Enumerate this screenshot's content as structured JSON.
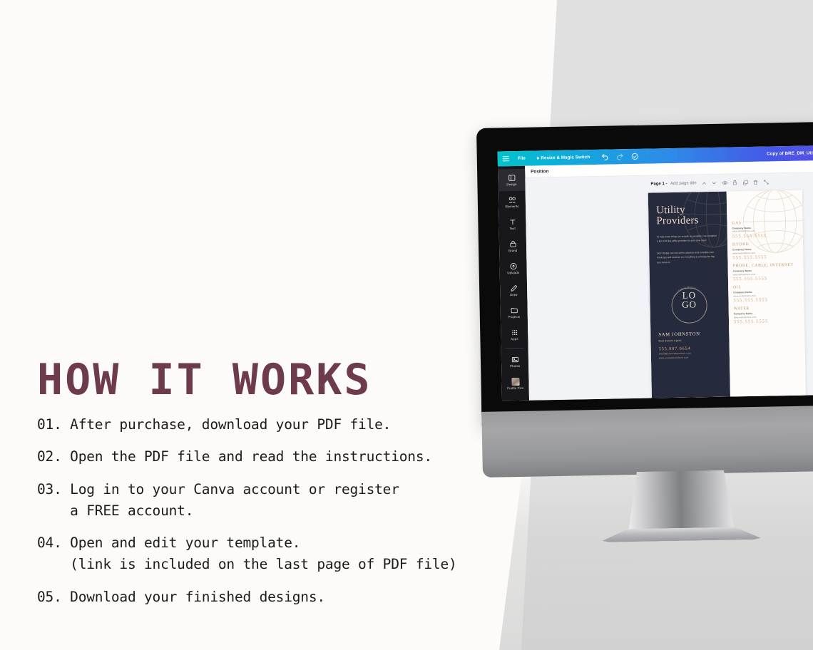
{
  "background": {
    "left_color": "#FCFBF9",
    "right_color": "#E2E2E2"
  },
  "instructions": {
    "title": "HOW IT WORKS",
    "steps": [
      "01. After purchase, download your PDF file.",
      "02. Open the PDF file and read the instructions.",
      "03. Log in to your Canva account or register\n    a FREE account.",
      "04. Open and edit your template.\n    (link is included on the last page of PDF file)",
      "05. Download your finished designs."
    ],
    "title_color": "#6E3B4C",
    "text_color": "#1C1C1C"
  },
  "canva": {
    "toolbar": {
      "menu_label": "hamburger-icon",
      "file_label": "File",
      "resize_label": "Resize & Magic Switch",
      "undo_label": "undo-icon",
      "redo_label": "redo-icon",
      "cloud_label": "cloud-saved-icon",
      "document_title": "Copy of BRE_DM_Utility-Provid",
      "gradient_start": "#00C3CC",
      "gradient_end": "#5B4FE3"
    },
    "subbar": {
      "position_label": "Position"
    },
    "sidebar": {
      "items": [
        {
          "label": "Design"
        },
        {
          "label": "Elements"
        },
        {
          "label": "Text"
        },
        {
          "label": "Brand"
        },
        {
          "label": "Uploads"
        },
        {
          "label": "Draw"
        },
        {
          "label": "Projects"
        },
        {
          "label": "Apps"
        },
        {
          "label": "Photos"
        },
        {
          "label": "Profile Pics"
        }
      ]
    },
    "page_header": {
      "page_number": "Page 1 -",
      "add_title": "Add page title",
      "icons": [
        "chevron-up-icon",
        "chevron-down-icon",
        "hide-page-icon",
        "lock-icon",
        "duplicate-icon",
        "trash-icon",
        "expand-icon"
      ]
    },
    "refresh_button": "refresh-icon"
  },
  "design": {
    "heading_line1": "Utility",
    "heading_line2": "Providers",
    "paragraph1": "To help make things as smooth as possible, I've compiled a list of all the utility providers in your new area!",
    "paragraph2": "Don't forget you can call in advance and schedule your hook-ups and services so everything is working the day you move in!",
    "logo_arc_text": "Your Family Realtor",
    "logo_line1": "LO",
    "logo_line2": "GO",
    "agent_name": "SAM JOHNSTON",
    "agent_role": "Real Estate Agent",
    "agent_phone": "555.987.0654",
    "agent_email": "email@yourwebsitehere.com",
    "agent_web": "www.yourwebsitehere.com",
    "dark_bg": "#252B3C",
    "accent": "#D2A06B",
    "utilities": [
      {
        "title": "GAS",
        "company": "Company Name",
        "website": "www.websitehere.com",
        "phone": "555.555.5555"
      },
      {
        "title": "HYDRO",
        "company": "Company Name",
        "website": "www.websitehere.com",
        "phone": "555.555.5555"
      },
      {
        "title": "PHONE, CABLE, INTERNET",
        "company": "Company Name",
        "website": "www.websitehere.com",
        "phone": "555.555.5555"
      },
      {
        "title": "OIL",
        "company": "Company Name",
        "website": "www.websitehere.com",
        "phone": "555.555.5555"
      },
      {
        "title": "WATER",
        "company": "Company Name",
        "website": "www.websitehere.com",
        "phone": "555.555.5555"
      }
    ]
  }
}
